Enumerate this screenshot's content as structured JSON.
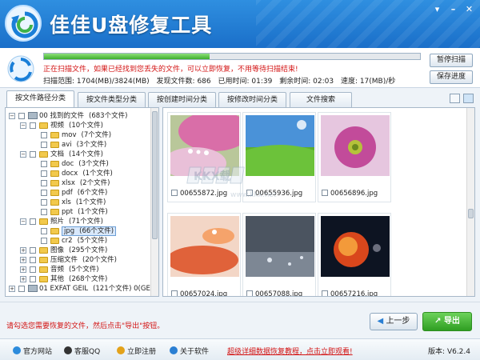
{
  "app": {
    "title": "佳佳U盘修复工具"
  },
  "window": {
    "menu_icon": "down-arrow-icon",
    "minimize_icon": "minimize-icon",
    "close_icon": "close-icon"
  },
  "scan": {
    "progress_percent": 44,
    "message": "正在扫描文件，如果已经找到您丢失的文件，可以立即恢复，不用等待扫描结束!",
    "range": "扫描范围: 1704(MB)/3824(MB)",
    "found": "发现文件数: 686",
    "elapsed": "已用时间: 01:39",
    "remaining": "剩余时间: 02:03",
    "speed": "速度: 17(MB)/秒",
    "pause_label": "暂停扫描",
    "save_label": "保存进度"
  },
  "tabs": [
    {
      "label": "按文件路径分类",
      "active": true
    },
    {
      "label": "按文件类型分类",
      "active": false
    },
    {
      "label": "按创建时间分类",
      "active": false
    },
    {
      "label": "按修改时间分类",
      "active": false
    },
    {
      "label": "文件搜索",
      "active": false
    }
  ],
  "tree": [
    {
      "label": "00 找到的文件",
      "count": "(683个文件)"
    },
    {
      "label": "视频",
      "count": "(10个文件)"
    },
    {
      "label": "mov",
      "count": "(7个文件)"
    },
    {
      "label": "avi",
      "count": "(3个文件)"
    },
    {
      "label": "文档",
      "count": "(14个文件)"
    },
    {
      "label": "doc",
      "count": "(3个文件)"
    },
    {
      "label": "docx",
      "count": "(1个文件)"
    },
    {
      "label": "xlsx",
      "count": "(2个文件)"
    },
    {
      "label": "pdf",
      "count": "(6个文件)"
    },
    {
      "label": "xls",
      "count": "(1个文件)"
    },
    {
      "label": "ppt",
      "count": "(1个文件)"
    },
    {
      "label": "照片",
      "count": "(71个文件)"
    },
    {
      "label": "jpg",
      "count": "(66个文件)"
    },
    {
      "label": "cr2",
      "count": "(5个文件)"
    },
    {
      "label": "图像",
      "count": "(295个文件)"
    },
    {
      "label": "压缩文件",
      "count": "(20个文件)"
    },
    {
      "label": "音频",
      "count": "(5个文件)"
    },
    {
      "label": "其他",
      "count": "(268个文件)"
    },
    {
      "label": "01 EXFAT GEIL",
      "count": "(121个文件) 0(GE"
    }
  ],
  "files": [
    {
      "name": "00655872.jpg"
    },
    {
      "name": "00655936.jpg"
    },
    {
      "name": "00656896.jpg"
    },
    {
      "name": "00657024.jpg"
    },
    {
      "name": "00657088.jpg"
    },
    {
      "name": "00657216.jpg"
    }
  ],
  "watermark": {
    "logo_text": "KKX载",
    "url": "www.kkx.net"
  },
  "bottom": {
    "hint": "请勾选您需要恢复的文件，然后点击\"导出\"按钮。",
    "prev_label": "上一步",
    "export_label": "导出"
  },
  "footer": {
    "links": [
      {
        "label": "官方网站",
        "icon": "ie-icon"
      },
      {
        "label": "客服QQ",
        "icon": "qq-icon"
      },
      {
        "label": "立即注册",
        "icon": "register-icon"
      },
      {
        "label": "关于软件",
        "icon": "info-icon"
      }
    ],
    "promo": "超级详细数据恢复教程，点击立即观看!",
    "version": "版本: V6.2.4"
  },
  "colors": {
    "title_blue": "#1a6fc9",
    "progress_green": "#3cae2c",
    "alert_red": "#d31414",
    "export_green": "#2f9e22"
  }
}
